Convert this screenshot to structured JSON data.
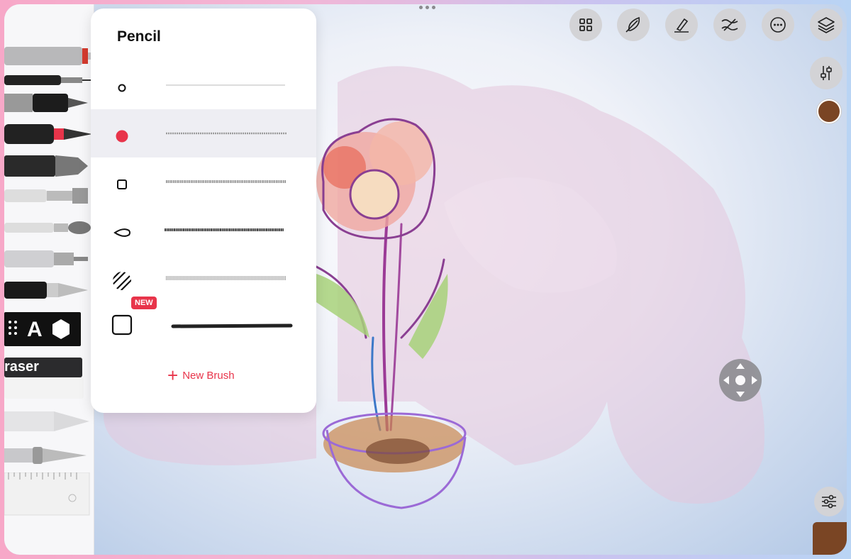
{
  "panel": {
    "title": "Pencil",
    "new_badge": "NEW",
    "new_brush_label": "New Brush",
    "brushes": [
      {
        "icon": "circle-outline-small-icon"
      },
      {
        "icon": "dot-filled-red-icon"
      },
      {
        "icon": "square-outline-small-icon"
      },
      {
        "icon": "teardrop-icon"
      },
      {
        "icon": "hatch-circle-icon"
      },
      {
        "icon": "square-outline-large-icon"
      }
    ]
  },
  "tools": [
    {
      "name": "mechanical-pencil"
    },
    {
      "name": "fine-liner"
    },
    {
      "name": "marker"
    },
    {
      "name": "brush-pen"
    },
    {
      "name": "watercolor-marker"
    },
    {
      "name": "flat-brush"
    },
    {
      "name": "round-brush"
    },
    {
      "name": "technical-pen"
    },
    {
      "name": "fountain-pen"
    },
    {
      "name": "pattern-stamp"
    },
    {
      "name": "eraser"
    },
    {
      "name": "pencil-knife"
    },
    {
      "name": "exacto-knife"
    },
    {
      "name": "ruler"
    }
  ],
  "pattern_stamp": {
    "letter": "A"
  },
  "eraser_label": "raser",
  "toolbar": {
    "icons": [
      "grid-icon",
      "feather-icon",
      "pen-stroke-icon",
      "waves-icon",
      "more-icon",
      "layers-icon"
    ]
  },
  "colors": {
    "accent": "#e8344a",
    "current_color": "#7a4524"
  }
}
